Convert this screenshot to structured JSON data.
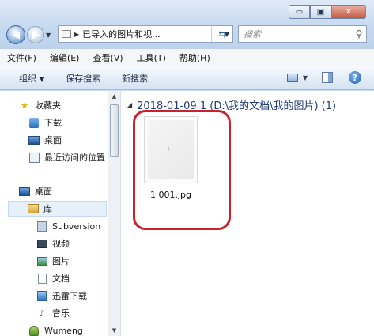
{
  "window": {
    "controls": {
      "minimize": "▭",
      "maximize": "▣",
      "close": "✕"
    }
  },
  "address": {
    "path": "已导入的图片和视...",
    "search_placeholder": "搜索"
  },
  "menu": [
    "文件(F)",
    "编辑(E)",
    "查看(V)",
    "工具(T)",
    "帮助(H)"
  ],
  "toolbar": {
    "organize": "组织",
    "save_search": "保存搜索",
    "new_search": "新搜索"
  },
  "nav": {
    "favorites": "收藏夹",
    "downloads": "下载",
    "desktop_fav": "桌面",
    "recent": "最近访问的位置",
    "desktop": "桌面",
    "libraries": "库",
    "subversion": "Subversion",
    "videos": "视频",
    "pictures": "图片",
    "documents": "文档",
    "xunlei": "迅雷下载",
    "music": "音乐",
    "user": "Wumeng"
  },
  "content": {
    "group_header": "2018-01-09 1 (D:\\我的文档\\我的图片) (1)",
    "file_name": "1 001.jpg"
  },
  "annotation_color": "#c8232c"
}
